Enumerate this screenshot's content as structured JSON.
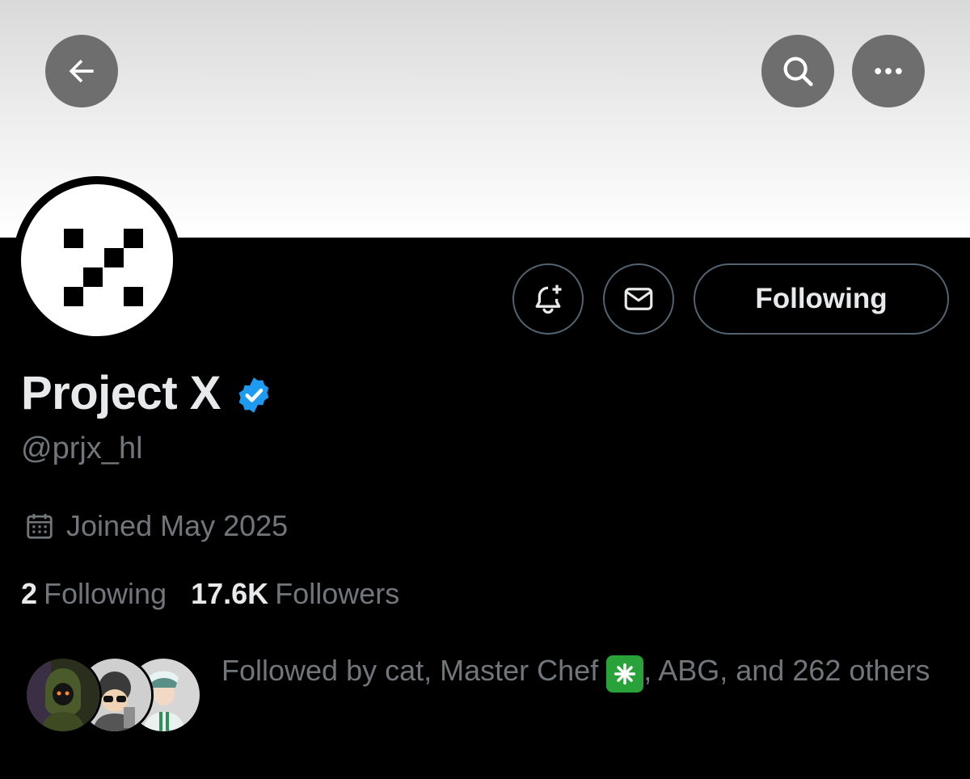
{
  "profile": {
    "display_name": "Project X",
    "handle": "@prjx_hl",
    "joined": "Joined May 2025",
    "following_count": "2",
    "following_label": "Following",
    "followers_count": "17.6K",
    "followers_label": "Followers",
    "followed_by_prefix": "Followed by cat, Master Chef ",
    "followed_by_suffix": ", ABG, and 262 others"
  },
  "actions": {
    "following_button_label": "Following"
  },
  "icons": {
    "back": "arrow-left-icon",
    "search": "search-icon",
    "more": "more-icon",
    "notify": "bell-plus-icon",
    "message": "envelope-icon",
    "verified": "verified-badge-icon",
    "calendar": "calendar-icon",
    "sparkle": "sparkle-emoji-icon"
  },
  "colors": {
    "background": "#000000",
    "primary_text": "#e7e9ea",
    "secondary_text": "#71767b",
    "verified_blue": "#1d9bf0",
    "border": "#536471"
  }
}
